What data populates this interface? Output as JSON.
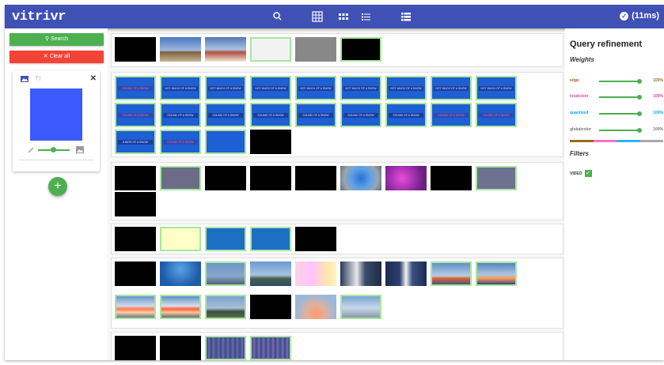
{
  "app": {
    "title": "vitrivr"
  },
  "topbar": {
    "status_text": "(11ms)"
  },
  "sidebar": {
    "search_label": "Search",
    "clear_label": "Clear all",
    "add_label": "+",
    "query_card": {
      "image_tab": "image",
      "text_tab": "Tт",
      "close": "✕",
      "color": "#3d5afe"
    }
  },
  "results": {
    "caption_texts": [
      "SOUND OF A SNOW",
      "NOT MUCH OF A SNOW",
      "A BIRD OF A SNOW"
    ]
  },
  "refinement": {
    "title": "Query refinement",
    "weights_heading": "Weights",
    "filters_heading": "Filters",
    "weights": [
      {
        "label": "edge",
        "value": "100%",
        "color": "#9c6b1e"
      },
      {
        "label": "localcolor",
        "value": "100%",
        "color": "#e040a0"
      },
      {
        "label": "quantized",
        "value": "100%",
        "color": "#03a9f4"
      },
      {
        "label": "globalcolor",
        "value": "100%",
        "color": "#757575"
      }
    ],
    "filters": [
      {
        "label": "VIDEO",
        "checked": true
      }
    ]
  },
  "colors": {
    "accent": "#3f51b5",
    "success": "#4caf50",
    "danger": "#f44336",
    "highlight": "#a8e6a0"
  }
}
